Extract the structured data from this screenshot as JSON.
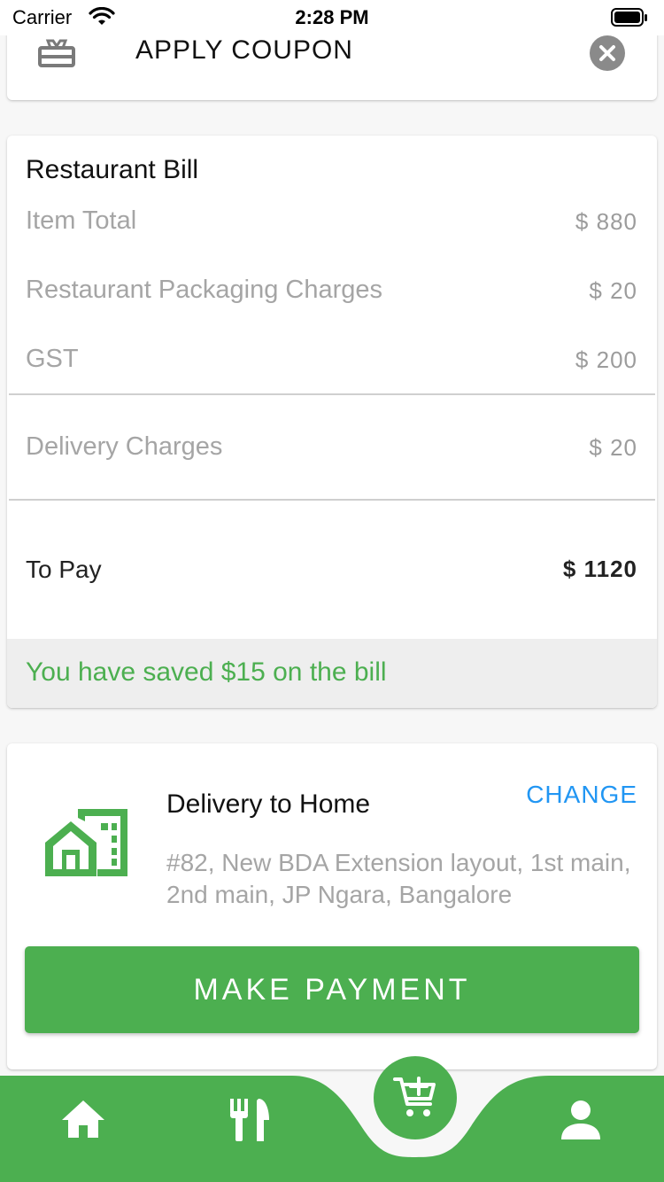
{
  "status_bar": {
    "carrier": "Carrier",
    "time": "2:28 PM"
  },
  "coupon": {
    "label": "APPLY COUPON",
    "icon": "coupon-icon",
    "close_icon": "close-icon"
  },
  "bill": {
    "title": "Restaurant Bill",
    "rows": [
      {
        "label": "Item Total",
        "value": "$ 880"
      },
      {
        "label": "Restaurant Packaging Charges",
        "value": "$ 20"
      },
      {
        "label": "GST",
        "value": "$ 200"
      }
    ],
    "delivery": {
      "label": "Delivery Charges",
      "value": "$ 20"
    },
    "to_pay": {
      "label": "To Pay",
      "value": "$ 1120"
    },
    "saved_text": "You have saved $15 on the bill"
  },
  "delivery": {
    "title": "Delivery to Home",
    "change_label": "CHANGE",
    "address": "#82, New BDA Extension layout, 1st main, 2nd main, JP Ngara, Bangalore",
    "pay_button": "MAKE PAYMENT"
  },
  "bottom_nav": {
    "items": [
      "home-icon",
      "restaurant-icon",
      "cart-add-icon",
      "profile-icon"
    ]
  },
  "colors": {
    "accent": "#4caf50",
    "link": "#2196f3",
    "muted_text": "#a5a5a5"
  }
}
